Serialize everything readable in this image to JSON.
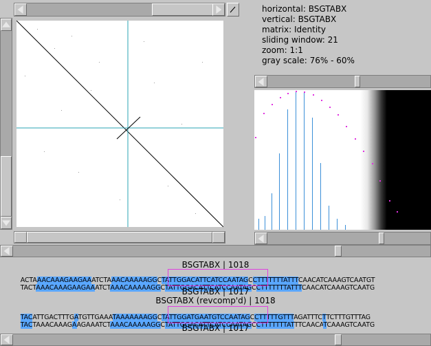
{
  "info": {
    "horizontal": "horizontal: BSGTABX",
    "vertical": "vertical: BSGTABX",
    "matrix": "matrix: Identity",
    "window": "sliding window: 21",
    "zoom": "zoom: 1:1",
    "grayscale": "gray scale: 76% - 60%"
  },
  "alignment1": {
    "top_label": "BSGTABX | 1018",
    "line1": "ACTAAACAAAGAAGAAATCTAAACAAAAAGGCTATTGGACATTCATCCAATAGCCTTTTTTTATTTCAACATCAAAGTCAATGT",
    "line2": "TACTAAACAAAGAAGAAATCTAAACAAAAAGGCTATTGGACATTCATCCAATAGCCTTTTTTTATTTCAACATCAAAGTCAATG",
    "bottom_label": "BSGTABX | 1017"
  },
  "alignment2": {
    "top_label": "BSGTABX (revcomp'd) | 1018",
    "line1": "TACATTGACTTTGATGTTGAAATAAAAAAAGGCTATTGGATGAATGTCCAATAGCCTTTTTGTTTAGATTTCTTCTTTGTTTAG",
    "line2": "TACTAAACAAAGAAGAAATCTAAACAAAAAGGCTATTGGACATTCATCCAATAGCCTTTTTTTATTTCAACATCAAAGTCAATG",
    "bottom_label": "BSGTABX | 1017"
  },
  "icons": {
    "left": "arrow-left-icon",
    "right": "arrow-right-icon",
    "up": "arrow-up-icon",
    "down": "arrow-down-icon"
  },
  "colors": {
    "crosshair": "#2aa3b3",
    "highlight": "#5aa7ff",
    "match_box": "#e040e0",
    "histogram_bar": "#3a8fd8",
    "histogram_dot": "#e030e0"
  }
}
